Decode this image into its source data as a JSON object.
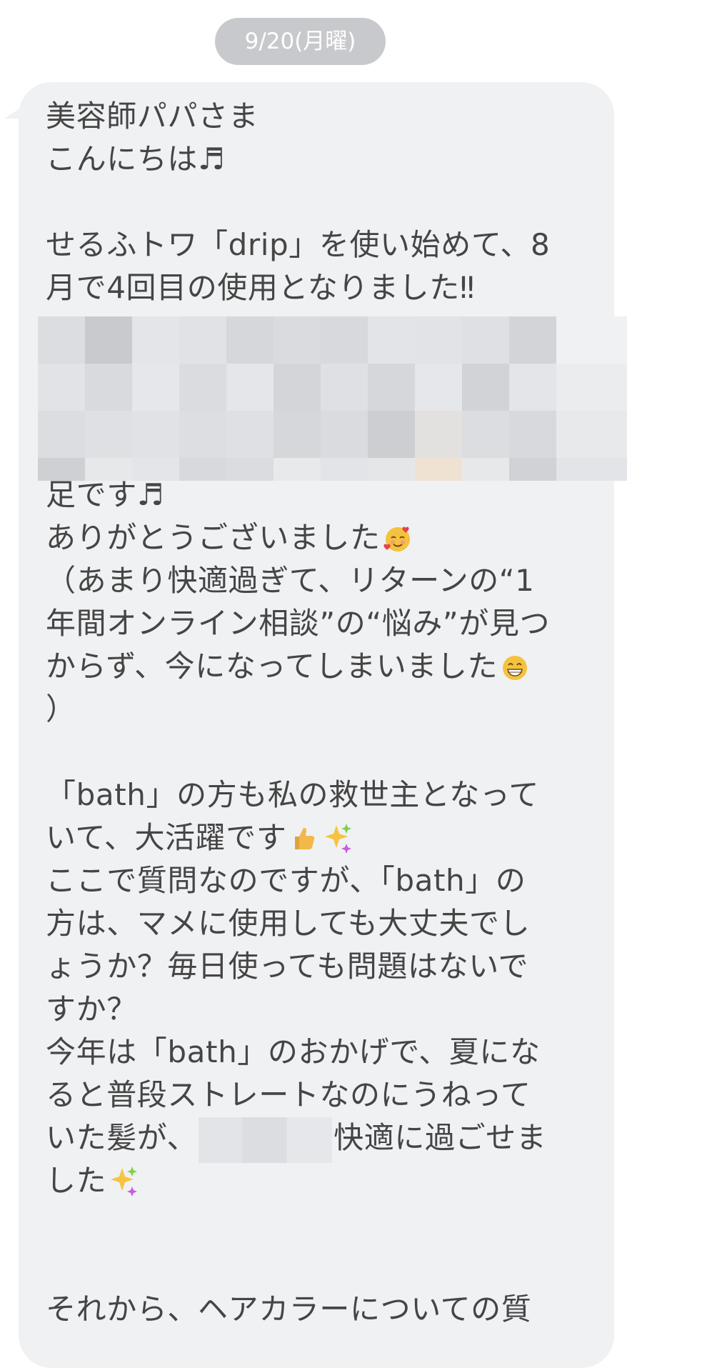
{
  "date_separator": "9/20(月曜)",
  "message": {
    "lines": [
      "美容師パパさま",
      "こんにちは♬",
      "",
      "せるふトワ「drip」を使い始めて、8",
      "月で4回目の使用となりました‼",
      "足です♬",
      "ありがとうございました",
      "（あまり快適過ぎて、リターンの“1",
      "年間オンライン相談”の“悩み”が見つ",
      "からず、今になってしまいました",
      "）",
      "",
      "「bath」の方も私の救世主となって",
      "いて、大活躍です",
      "ここで質問なのですが、「bath」の",
      "方は、マメに使用しても大丈夫でし",
      "ょうか？毎日使っても問題はないで",
      "すか？",
      "今年は「bath」のおかげで、夏にな",
      "ると普段ストレートなのにうねって",
      "いた髪が、",
      "快適に過ごせま",
      "した",
      "",
      "",
      "それから、ヘアカラーについての質"
    ]
  },
  "icons": {
    "smile_hearts": "smiling-face-with-hearts-icon",
    "grin": "grinning-face-icon",
    "thumbs_up": "thumbs-up-icon",
    "sparkles": "sparkles-icon"
  },
  "colors": {
    "bubble": "#f0f1f3",
    "date_pill": "#c8c9cc",
    "text": "#454545"
  }
}
